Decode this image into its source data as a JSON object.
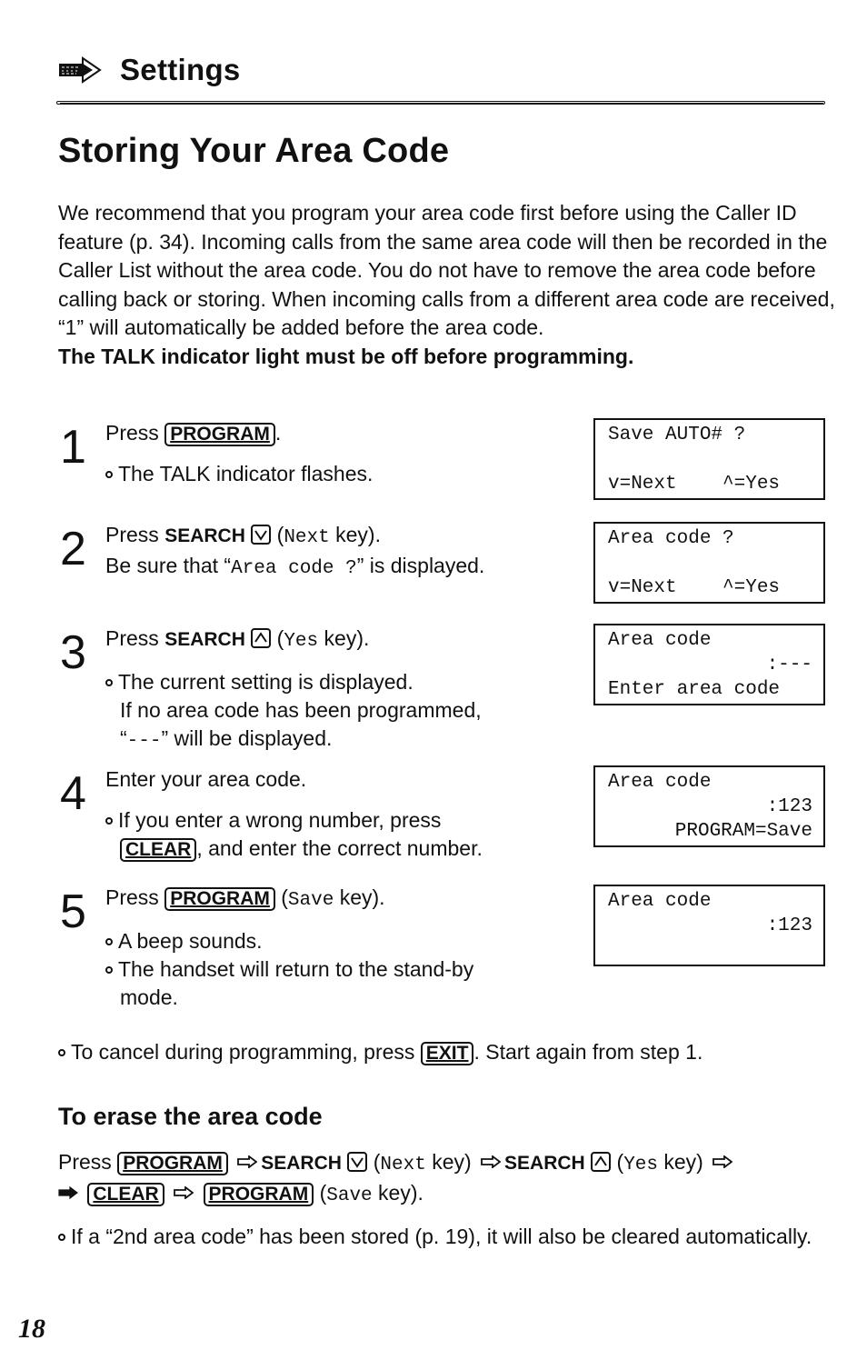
{
  "header": {
    "section_icon": "arrow-right-icon",
    "section_title": "Settings"
  },
  "title": "Storing Your Area Code",
  "intro": {
    "paragraph": "We recommend that you program your area code first before using the Caller ID feature (p. 34). Incoming calls from the same area code will then be recorded in the Caller List without the area code. You do not have to remove the area code before calling back or storing. When incoming calls from a different area code are received, “1” will automatically be added before the area code.",
    "warning": "The TALK indicator light must be off before programming."
  },
  "steps": [
    {
      "number": "1",
      "press": "Press",
      "key": "PROGRAM",
      "after": ".",
      "bullets": [
        "The TALK indicator flashes."
      ],
      "display": [
        "Save AUTO# ?",
        "",
        "v=Next    ^=Yes"
      ]
    },
    {
      "number": "2",
      "press": "Press",
      "search": "SEARCH",
      "key_icon": "chevron-down-icon",
      "paren_open": "(",
      "mono": "Next",
      "paren_close": " key).",
      "line2_pre": "Be sure that “",
      "line2_mono": "Area code ?",
      "line2_post": "” is displayed.",
      "display": [
        "Area code ?",
        "",
        "v=Next    ^=Yes"
      ]
    },
    {
      "number": "3",
      "press": "Press",
      "search": "SEARCH",
      "key_icon": "chevron-up-icon",
      "paren_open": "(",
      "mono": "Yes",
      "paren_close": " key).",
      "bullets": [
        "The current setting is displayed."
      ],
      "extra_line": "If no area code has been programmed,",
      "extra_pre": "“",
      "extra_mono": "---",
      "extra_post": "” will be displayed.",
      "display": [
        "Area code",
        ":---",
        "Enter area code"
      ]
    },
    {
      "number": "4",
      "text": "Enter your area code.",
      "bullet_pre": "If you enter a wrong number, press",
      "key": "CLEAR",
      "bullet_post": ", and enter the correct number.",
      "display": [
        "Area code",
        ":123",
        "PROGRAM=Save"
      ]
    },
    {
      "number": "5",
      "press": "Press",
      "key": "PROGRAM",
      "paren_open": "(",
      "mono": "Save",
      "paren_close": " key).",
      "bullets": [
        "A beep sounds.",
        "The handset will return to the stand-by",
        "mode."
      ],
      "display": [
        "Area code",
        ":123",
        ""
      ]
    }
  ],
  "cancel_note": {
    "pre": "To cancel during programming, press",
    "key": "EXIT",
    "post": ". Start again from step 1."
  },
  "erase": {
    "heading": "To erase the area code",
    "press": "Press",
    "key_program": "PROGRAM",
    "search": "SEARCH",
    "next_mono": "Next",
    "yes_mono": "Yes",
    "key_word": " key)",
    "paren_open": "(",
    "key_clear": "CLEAR",
    "save_mono": "Save",
    "end": " key).",
    "note": "If a “2nd area code” has been stored (p. 19), it will also be cleared automatically."
  },
  "page_number": "18"
}
